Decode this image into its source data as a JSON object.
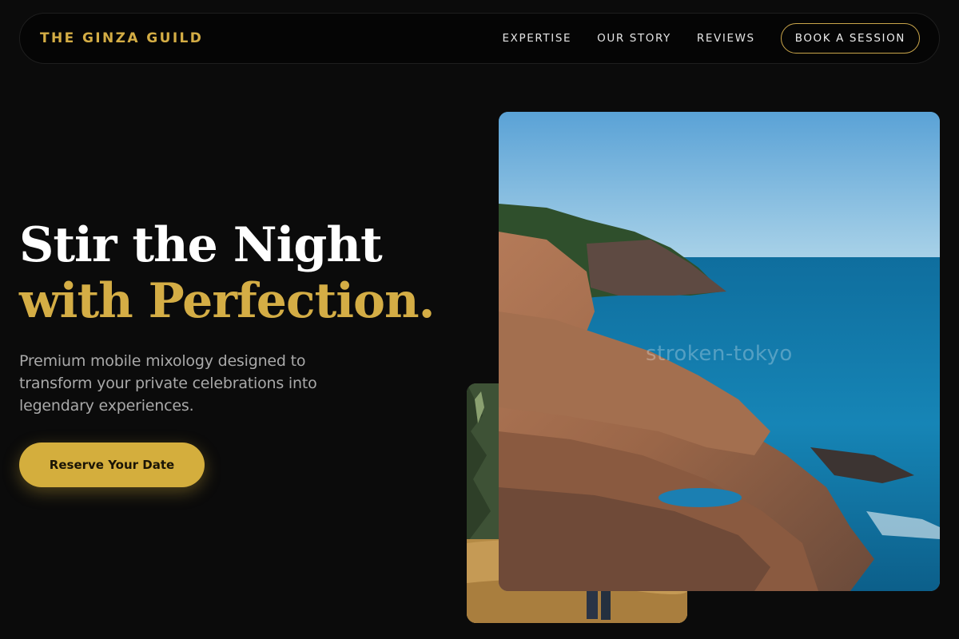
{
  "brand": {
    "name": "THE GINZA GUILD"
  },
  "nav": {
    "links": [
      "EXPERTISE",
      "OUR STORY",
      "REVIEWS"
    ],
    "cta_label": "BOOK A SESSION"
  },
  "hero": {
    "headline_line1": "Stir the Night",
    "headline_line2": "with Perfection.",
    "subtitle": "Premium mobile mixology designed to transform your private celebrations into legendary experiences.",
    "cta_label": "Reserve Your Date"
  },
  "images": {
    "main_photo_watermark": "stroken-tokyo",
    "main_photo_subject": "rocky-coastline-photo",
    "back_photo_subject": "woodland-path-photo"
  },
  "colors": {
    "background": "#0b0b0b",
    "accent_gold": "#d4ad45",
    "text_white": "#ffffff",
    "text_muted": "#a9a9a9"
  }
}
